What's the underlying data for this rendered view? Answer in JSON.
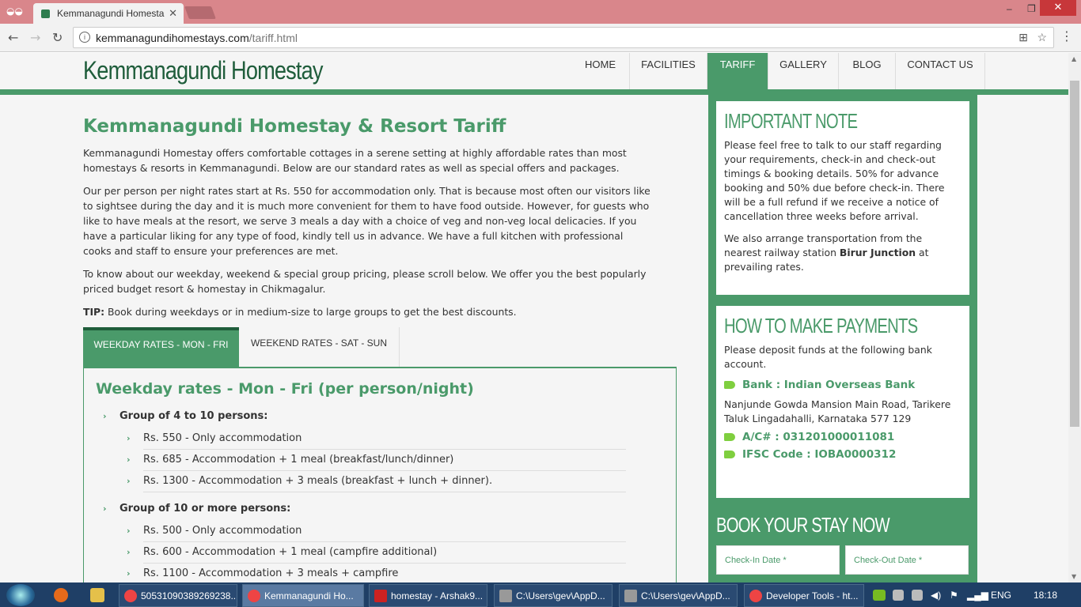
{
  "browser": {
    "tab_title": "Kemmanagundi Homesta",
    "url_domain": "kemmanagundihomestays.com",
    "url_path": "/tariff.html",
    "close_glyph": "✕",
    "win_minimize": "‒",
    "win_restore": "❐",
    "win_close": "✕"
  },
  "site": {
    "logo": "Kemmanagundi Homestay",
    "nav": [
      "HOME",
      "FACILITIES",
      "TARIFF",
      "GALLERY",
      "BLOG",
      "CONTACT US"
    ],
    "active_nav": "TARIFF"
  },
  "main": {
    "title": "Kemmanagundi Homestay & Resort Tariff",
    "p1": "Kemmanagundi Homestay offers comfortable cottages in a serene setting at highly affordable rates than most homestays & resorts in Kemmanagundi. Below are our standard rates as well as special offers and packages.",
    "p2": "Our per person per night rates start at Rs. 550 for accommodation only. That is because most often our visitors like to sightsee during the day and it is much more convenient for them to have food outside. However, for guests who like to have meals at the resort, we serve 3 meals a day with a choice of veg and non-veg local delicacies. If you have a particular liking for any type of food, kindly tell us in advance. We have a full kitchen with professional cooks and staff to ensure your preferences are met.",
    "p3": "To know about our weekday, weekend & special group pricing, please scroll below. We offer you the best popularly priced budget resort & homestay in Chikmagalur.",
    "tip_label": "TIP:",
    "tip_text": " Book during weekdays or in medium-size to large groups to get the best discounts.",
    "tabs": [
      "WEEKDAY RATES - MON - FRI",
      "WEEKEND RATES - SAT - SUN"
    ],
    "panel_title": "Weekday rates - Mon - Fri (per person/night)",
    "groups": [
      {
        "label": "Group of 4 to 10 persons:",
        "items": [
          "Rs. 550 - Only accommodation",
          "Rs. 685 - Accommodation + 1 meal (breakfast/lunch/dinner)",
          "Rs. 1300 - Accommodation + 3 meals (breakfast + lunch + dinner)."
        ]
      },
      {
        "label": "Group of 10 or more persons:",
        "items": [
          "Rs. 500 - Only accommodation",
          "Rs. 600 - Accommodation + 1 meal (campfire additional)",
          "Rs. 1100 - Accommodation + 3 meals + campfire"
        ]
      }
    ]
  },
  "sidebar": {
    "note_title": "IMPORTANT NOTE",
    "note_p1": "Please feel free to talk to our staff regarding your requirements, check-in and check-out timings & booking details. 50% for advance booking and 50% due before check-in. There will be a full refund if we receive a notice of cancellation three weeks before arrival.",
    "note_p2_a": "We also arrange transportation from the nearest railway station ",
    "note_p2_b": "Birur Junction",
    "note_p2_c": " at prevailing rates.",
    "pay_title": "HOW TO MAKE PAYMENTS",
    "pay_p": "Please deposit funds at the following bank account.",
    "bank": "Bank : Indian Overseas Bank",
    "address": "Nanjunde Gowda Mansion Main Road, Tarikere Taluk Lingadahalli, Karnataka 577 129",
    "account": "A/C# : 031201000011081",
    "ifsc": "IFSC Code : IOBA0000312",
    "book_title": "BOOK YOUR STAY NOW",
    "checkin_placeholder": "Check-In Date *",
    "checkout_placeholder": "Check-Out Date *"
  },
  "taskbar": {
    "items": [
      "50531090389269238...",
      "Kemmanagundi Ho...",
      "homestay - Arshak9...",
      "C:\\Users\\gev\\AppD...",
      "C:\\Users\\gev\\AppD...",
      "Developer Tools - ht..."
    ],
    "lang": "ENG",
    "time": "18:18"
  },
  "colors": {
    "accent": "#4a9a6a",
    "dark_green": "#1f5d3b"
  }
}
